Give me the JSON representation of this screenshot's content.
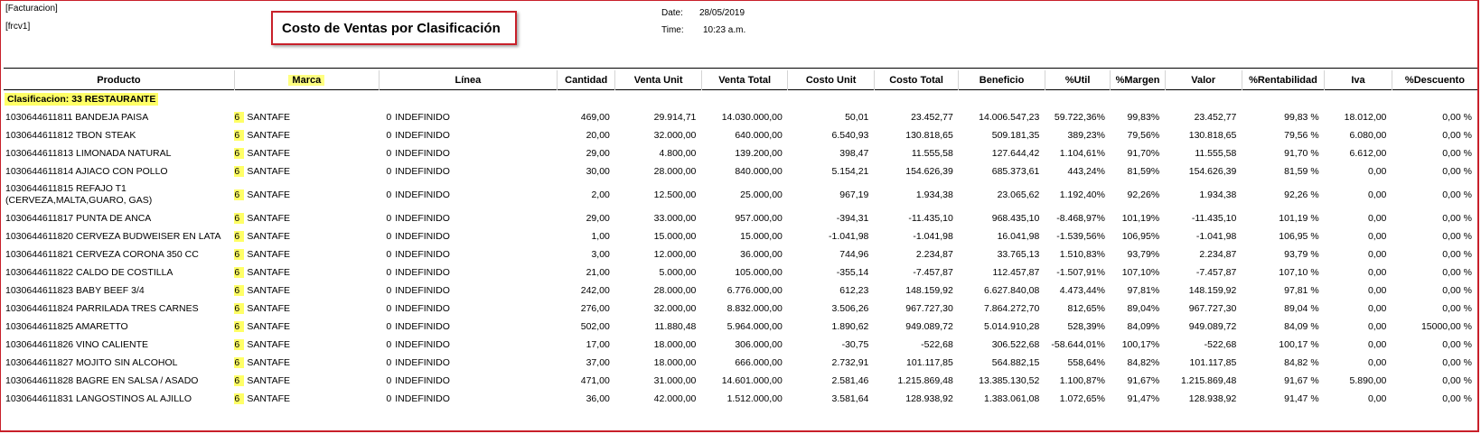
{
  "header": {
    "module": "[Facturacion]",
    "code": "[frcv1]",
    "title": "Costo de Ventas por Clasificación",
    "date_label": "Date:",
    "date_value": "28/05/2019",
    "time_label": "Time:",
    "time_value": "10:23 a.m."
  },
  "columns": [
    "Producto",
    "Marca",
    "Línea",
    "Cantidad",
    "Venta Unit",
    "Venta Total",
    "Costo Unit",
    "Costo Total",
    "Beneficio",
    "%Util",
    "%Margen",
    "Valor",
    "%Rentabilidad",
    "Iva",
    "%Descuento"
  ],
  "group": {
    "label": "Clasificacion: 33  RESTAURANTE"
  },
  "colors": {
    "highlight": "#ffff66",
    "frame": "#c8202a"
  },
  "rows": [
    {
      "producto": "1030644611811 BANDEJA PAISA",
      "marca_code": "6",
      "marca": "SANTAFE",
      "linea_code": "0",
      "linea": "INDEFINIDO",
      "cantidad": "469,00",
      "venta_unit": "29.914,71",
      "venta_total": "14.030.000,00",
      "costo_unit": "50,01",
      "costo_total": "23.452,77",
      "beneficio": "14.006.547,23",
      "util": "59.722,36%",
      "margen": "99,83%",
      "valor": "23.452,77",
      "rentabilidad": "99,83 %",
      "iva": "18.012,00",
      "descuento": "0,00 %"
    },
    {
      "producto": "1030644611812 TBON STEAK",
      "marca_code": "6",
      "marca": "SANTAFE",
      "linea_code": "0",
      "linea": "INDEFINIDO",
      "cantidad": "20,00",
      "venta_unit": "32.000,00",
      "venta_total": "640.000,00",
      "costo_unit": "6.540,93",
      "costo_total": "130.818,65",
      "beneficio": "509.181,35",
      "util": "389,23%",
      "margen": "79,56%",
      "valor": "130.818,65",
      "rentabilidad": "79,56 %",
      "iva": "6.080,00",
      "descuento": "0,00 %"
    },
    {
      "producto": "1030644611813 LIMONADA NATURAL",
      "marca_code": "6",
      "marca": "SANTAFE",
      "linea_code": "0",
      "linea": "INDEFINIDO",
      "cantidad": "29,00",
      "venta_unit": "4.800,00",
      "venta_total": "139.200,00",
      "costo_unit": "398,47",
      "costo_total": "11.555,58",
      "beneficio": "127.644,42",
      "util": "1.104,61%",
      "margen": "91,70%",
      "valor": "11.555,58",
      "rentabilidad": "91,70 %",
      "iva": "6.612,00",
      "descuento": "0,00 %"
    },
    {
      "producto": "1030644611814 AJIACO CON POLLO",
      "marca_code": "6",
      "marca": "SANTAFE",
      "linea_code": "0",
      "linea": "INDEFINIDO",
      "cantidad": "30,00",
      "venta_unit": "28.000,00",
      "venta_total": "840.000,00",
      "costo_unit": "5.154,21",
      "costo_total": "154.626,39",
      "beneficio": "685.373,61",
      "util": "443,24%",
      "margen": "81,59%",
      "valor": "154.626,39",
      "rentabilidad": "81,59 %",
      "iva": "0,00",
      "descuento": "0,00 %"
    },
    {
      "producto": "1030644611815 REFAJO T1 (CERVEZA,MALTA,GUARO, GAS)",
      "marca_code": "6",
      "marca": "SANTAFE",
      "linea_code": "0",
      "linea": "INDEFINIDO",
      "cantidad": "2,00",
      "venta_unit": "12.500,00",
      "venta_total": "25.000,00",
      "costo_unit": "967,19",
      "costo_total": "1.934,38",
      "beneficio": "23.065,62",
      "util": "1.192,40%",
      "margen": "92,26%",
      "valor": "1.934,38",
      "rentabilidad": "92,26 %",
      "iva": "0,00",
      "descuento": "0,00 %",
      "tall": true
    },
    {
      "producto": "1030644611817 PUNTA DE ANCA",
      "marca_code": "6",
      "marca": "SANTAFE",
      "linea_code": "0",
      "linea": "INDEFINIDO",
      "cantidad": "29,00",
      "venta_unit": "33.000,00",
      "venta_total": "957.000,00",
      "costo_unit": "-394,31",
      "costo_total": "-11.435,10",
      "beneficio": "968.435,10",
      "util": "-8.468,97%",
      "margen": "101,19%",
      "valor": "-11.435,10",
      "rentabilidad": "101,19 %",
      "iva": "0,00",
      "descuento": "0,00 %"
    },
    {
      "producto": "1030644611820 CERVEZA BUDWEISER EN LATA",
      "marca_code": "6",
      "marca": "SANTAFE",
      "linea_code": "0",
      "linea": "INDEFINIDO",
      "cantidad": "1,00",
      "venta_unit": "15.000,00",
      "venta_total": "15.000,00",
      "costo_unit": "-1.041,98",
      "costo_total": "-1.041,98",
      "beneficio": "16.041,98",
      "util": "-1.539,56%",
      "margen": "106,95%",
      "valor": "-1.041,98",
      "rentabilidad": "106,95 %",
      "iva": "0,00",
      "descuento": "0,00 %"
    },
    {
      "producto": "1030644611821 CERVEZA CORONA 350 CC",
      "marca_code": "6",
      "marca": "SANTAFE",
      "linea_code": "0",
      "linea": "INDEFINIDO",
      "cantidad": "3,00",
      "venta_unit": "12.000,00",
      "venta_total": "36.000,00",
      "costo_unit": "744,96",
      "costo_total": "2.234,87",
      "beneficio": "33.765,13",
      "util": "1.510,83%",
      "margen": "93,79%",
      "valor": "2.234,87",
      "rentabilidad": "93,79 %",
      "iva": "0,00",
      "descuento": "0,00 %"
    },
    {
      "producto": "1030644611822 CALDO DE COSTILLA",
      "marca_code": "6",
      "marca": "SANTAFE",
      "linea_code": "0",
      "linea": "INDEFINIDO",
      "cantidad": "21,00",
      "venta_unit": "5.000,00",
      "venta_total": "105.000,00",
      "costo_unit": "-355,14",
      "costo_total": "-7.457,87",
      "beneficio": "112.457,87",
      "util": "-1.507,91%",
      "margen": "107,10%",
      "valor": "-7.457,87",
      "rentabilidad": "107,10 %",
      "iva": "0,00",
      "descuento": "0,00 %"
    },
    {
      "producto": "1030644611823 BABY BEEF 3/4",
      "marca_code": "6",
      "marca": "SANTAFE",
      "linea_code": "0",
      "linea": "INDEFINIDO",
      "cantidad": "242,00",
      "venta_unit": "28.000,00",
      "venta_total": "6.776.000,00",
      "costo_unit": "612,23",
      "costo_total": "148.159,92",
      "beneficio": "6.627.840,08",
      "util": "4.473,44%",
      "margen": "97,81%",
      "valor": "148.159,92",
      "rentabilidad": "97,81 %",
      "iva": "0,00",
      "descuento": "0,00 %"
    },
    {
      "producto": "1030644611824 PARRILADA TRES CARNES",
      "marca_code": "6",
      "marca": "SANTAFE",
      "linea_code": "0",
      "linea": "INDEFINIDO",
      "cantidad": "276,00",
      "venta_unit": "32.000,00",
      "venta_total": "8.832.000,00",
      "costo_unit": "3.506,26",
      "costo_total": "967.727,30",
      "beneficio": "7.864.272,70",
      "util": "812,65%",
      "margen": "89,04%",
      "valor": "967.727,30",
      "rentabilidad": "89,04 %",
      "iva": "0,00",
      "descuento": "0,00 %"
    },
    {
      "producto": "1030644611825 AMARETTO",
      "marca_code": "6",
      "marca": "SANTAFE",
      "linea_code": "0",
      "linea": "INDEFINIDO",
      "cantidad": "502,00",
      "venta_unit": "11.880,48",
      "venta_total": "5.964.000,00",
      "costo_unit": "1.890,62",
      "costo_total": "949.089,72",
      "beneficio": "5.014.910,28",
      "util": "528,39%",
      "margen": "84,09%",
      "valor": "949.089,72",
      "rentabilidad": "84,09 %",
      "iva": "0,00",
      "descuento": "15000,00 %"
    },
    {
      "producto": "1030644611826 VINO CALIENTE",
      "marca_code": "6",
      "marca": "SANTAFE",
      "linea_code": "0",
      "linea": "INDEFINIDO",
      "cantidad": "17,00",
      "venta_unit": "18.000,00",
      "venta_total": "306.000,00",
      "costo_unit": "-30,75",
      "costo_total": "-522,68",
      "beneficio": "306.522,68",
      "util": "-58.644,01%",
      "margen": "100,17%",
      "valor": "-522,68",
      "rentabilidad": "100,17 %",
      "iva": "0,00",
      "descuento": "0,00 %"
    },
    {
      "producto": "1030644611827 MOJITO SIN ALCOHOL",
      "marca_code": "6",
      "marca": "SANTAFE",
      "linea_code": "0",
      "linea": "INDEFINIDO",
      "cantidad": "37,00",
      "venta_unit": "18.000,00",
      "venta_total": "666.000,00",
      "costo_unit": "2.732,91",
      "costo_total": "101.117,85",
      "beneficio": "564.882,15",
      "util": "558,64%",
      "margen": "84,82%",
      "valor": "101.117,85",
      "rentabilidad": "84,82 %",
      "iva": "0,00",
      "descuento": "0,00 %"
    },
    {
      "producto": "1030644611828 BAGRE EN SALSA / ASADO",
      "marca_code": "6",
      "marca": "SANTAFE",
      "linea_code": "0",
      "linea": "INDEFINIDO",
      "cantidad": "471,00",
      "venta_unit": "31.000,00",
      "venta_total": "14.601.000,00",
      "costo_unit": "2.581,46",
      "costo_total": "1.215.869,48",
      "beneficio": "13.385.130,52",
      "util": "1.100,87%",
      "margen": "91,67%",
      "valor": "1.215.869,48",
      "rentabilidad": "91,67 %",
      "iva": "5.890,00",
      "descuento": "0,00 %"
    },
    {
      "producto": "1030644611831 LANGOSTINOS AL AJILLO",
      "marca_code": "6",
      "marca": "SANTAFE",
      "linea_code": "0",
      "linea": "INDEFINIDO",
      "cantidad": "36,00",
      "venta_unit": "42.000,00",
      "venta_total": "1.512.000,00",
      "costo_unit": "3.581,64",
      "costo_total": "128.938,92",
      "beneficio": "1.383.061,08",
      "util": "1.072,65%",
      "margen": "91,47%",
      "valor": "128.938,92",
      "rentabilidad": "91,47 %",
      "iva": "0,00",
      "descuento": "0,00 %"
    }
  ]
}
